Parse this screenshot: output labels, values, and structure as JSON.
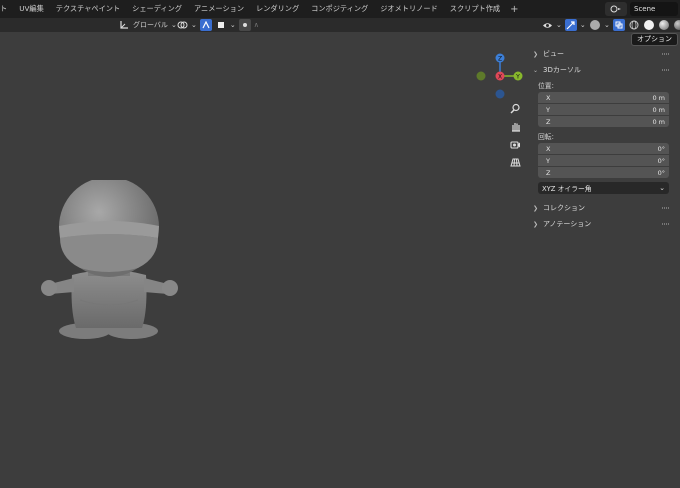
{
  "workspace_tabs": [
    "ト",
    "UV編集",
    "テクスチャペイント",
    "シェーディング",
    "アニメーション",
    "レンダリング",
    "コンポジティング",
    "ジオメトリノード",
    "スクリプト作成"
  ],
  "add_workspace": "+",
  "scene": {
    "name": "Scene"
  },
  "header": {
    "transform_orientation": "グローバル"
  },
  "tooltip": "オプション",
  "gizmo": {
    "z": "Z",
    "x": "X",
    "y": "Y"
  },
  "sidebar": {
    "view_panel": "ビュー",
    "cursor_panel": "3Dカーソル",
    "location_label": "位置:",
    "location": [
      {
        "axis": "X",
        "value": "0 m"
      },
      {
        "axis": "Y",
        "value": "0 m"
      },
      {
        "axis": "Z",
        "value": "0 m"
      }
    ],
    "rotation_label": "回転:",
    "rotation": [
      {
        "axis": "X",
        "value": "0°"
      },
      {
        "axis": "Y",
        "value": "0°"
      },
      {
        "axis": "Z",
        "value": "0°"
      }
    ],
    "rotation_mode": "XYZ オイラー角",
    "collection_panel": "コレクション",
    "annotation_panel": "アノテーション"
  },
  "colors": {
    "viewport_bg": "#3d3d3d",
    "header_bg": "#2b2b2b",
    "topbar_bg": "#1e1e1e",
    "axis_x": "#e04858",
    "axis_y": "#88b82c",
    "axis_z": "#3c7fd8",
    "accent": "#3a6ed0"
  },
  "icons": [
    "transform-orientation-icon",
    "pivot-icon",
    "snap-icon",
    "proportional-icon",
    "visibility-icon",
    "gizmo-icon",
    "overlay-icon",
    "xray-icon",
    "wireframe-shading-icon",
    "solid-shading-icon",
    "material-shading-icon",
    "rendered-shading-icon",
    "zoom-icon",
    "pan-hand-icon",
    "camera-icon",
    "grid-icon"
  ]
}
